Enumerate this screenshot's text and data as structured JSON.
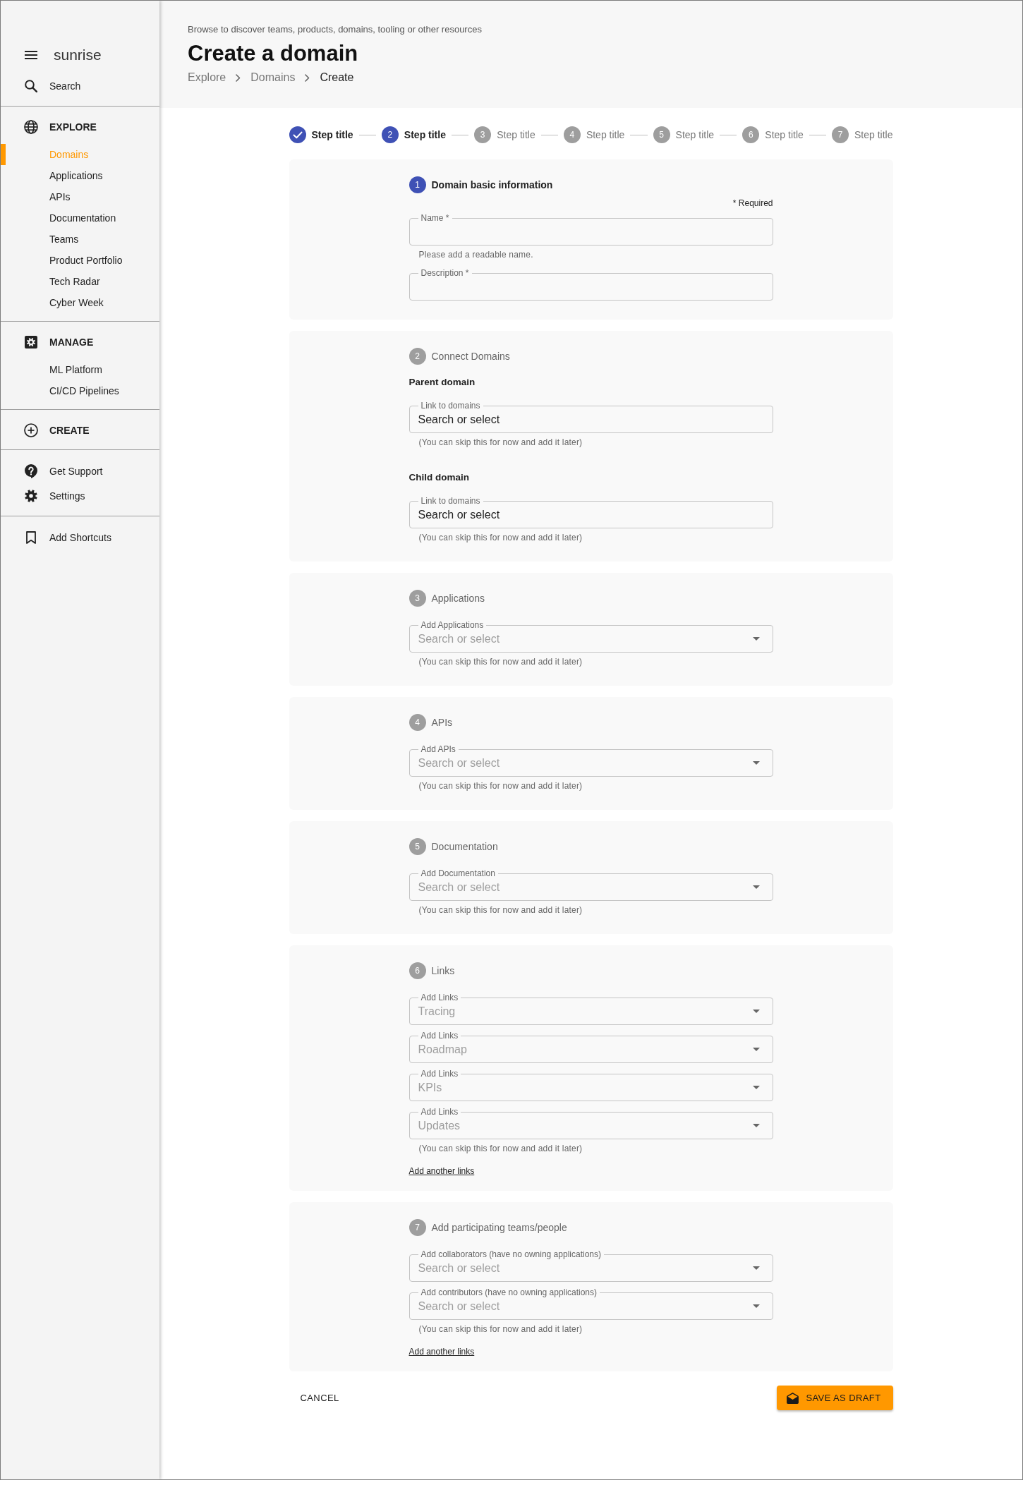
{
  "sidebar": {
    "brand": "sunrise",
    "search": "Search",
    "groups": [
      {
        "title": "EXPLORE",
        "items": [
          {
            "label": "Domains",
            "selected": true
          },
          {
            "label": "Applications",
            "selected": false
          },
          {
            "label": "APIs",
            "selected": false
          },
          {
            "label": "Documentation",
            "selected": false
          },
          {
            "label": "Teams",
            "selected": false
          },
          {
            "label": "Product Portfolio",
            "selected": false
          },
          {
            "label": "Tech Radar",
            "selected": false
          },
          {
            "label": "Cyber Week",
            "selected": false
          }
        ]
      },
      {
        "title": "MANAGE",
        "items": [
          {
            "label": "ML Platform",
            "selected": false
          },
          {
            "label": "CI/CD Pipelines",
            "selected": false
          }
        ]
      },
      {
        "title": "CREATE"
      }
    ],
    "support_links": [
      "Get Support",
      "Settings"
    ],
    "shortcuts": "Add Shortcuts"
  },
  "header": {
    "subtitle": "Browse to discover teams, products, domains, tooling or other resources",
    "title": "Create a domain",
    "breadcrumbs": [
      {
        "label": "Explore",
        "current": false
      },
      {
        "label": "Domains",
        "current": false
      },
      {
        "label": "Create",
        "current": true
      }
    ]
  },
  "stepper": {
    "steps": [
      {
        "label": "Step title",
        "completed": true,
        "selected": false
      },
      {
        "number": "2",
        "label": "Step title",
        "completed": false,
        "selected": true
      },
      {
        "number": "3",
        "label": "Step title",
        "completed": false,
        "selected": false
      },
      {
        "number": "4",
        "label": "Step title",
        "completed": false,
        "selected": false
      },
      {
        "number": "5",
        "label": "Step title",
        "completed": false,
        "selected": false
      },
      {
        "number": "6",
        "label": "Step title",
        "completed": false,
        "selected": false
      },
      {
        "number": "7",
        "label": "Step title",
        "completed": false,
        "selected": false
      }
    ]
  },
  "sections": [
    {
      "number": "1",
      "title": "Domain basic information",
      "active": true,
      "blocks": [
        {
          "kind": "note",
          "text": "* Required"
        },
        {
          "kind": "text_field",
          "label": "Name *",
          "helper": "Please add a readable name."
        },
        {
          "kind": "text_field",
          "label": "Description *"
        }
      ]
    },
    {
      "number": "2",
      "title": "Connect Domains",
      "active": false,
      "blocks": [
        {
          "kind": "subheading",
          "text": "Parent domain"
        },
        {
          "kind": "text_field",
          "label": "Link to domains",
          "value": "Search or select",
          "helper": "(You can skip this for now and add it later)"
        },
        {
          "kind": "subheading",
          "text": "Child domain"
        },
        {
          "kind": "text_field",
          "label": "Link to domains",
          "value": "Search or select",
          "helper": "(You can skip this for now and add it later)"
        }
      ]
    },
    {
      "number": "3",
      "title": "Applications",
      "active": false,
      "blocks": [
        {
          "kind": "select_field",
          "label": "Add Applications",
          "placeholder": "Search or select",
          "helper": "(You can skip this for now and add it later)"
        }
      ]
    },
    {
      "number": "4",
      "title": "APIs",
      "active": false,
      "blocks": [
        {
          "kind": "select_field",
          "label": "Add APIs",
          "placeholder": "Search or select",
          "helper": "(You can skip this for now and add it later)"
        }
      ]
    },
    {
      "number": "5",
      "title": "Documentation",
      "active": false,
      "blocks": [
        {
          "kind": "select_field",
          "label": "Add Documentation",
          "placeholder": "Search or select",
          "helper": "(You can skip this for now and add it later)"
        }
      ]
    },
    {
      "number": "6",
      "title": "Links",
      "active": false,
      "blocks": [
        {
          "kind": "select_field",
          "label": "Add Links",
          "placeholder": "Tracing"
        },
        {
          "kind": "select_field",
          "label": "Add Links",
          "placeholder": "Roadmap"
        },
        {
          "kind": "select_field",
          "label": "Add Links",
          "placeholder": "KPIs"
        },
        {
          "kind": "select_field",
          "label": "Add Links",
          "placeholder": "Updates",
          "helper": "(You can skip this for now and add it later)"
        },
        {
          "kind": "link",
          "text": "Add another links"
        }
      ]
    },
    {
      "number": "7",
      "title": "Add participating teams/people",
      "active": false,
      "blocks": [
        {
          "kind": "select_field",
          "label": "Add collaborators (have no owning applications)",
          "placeholder": "Search or select"
        },
        {
          "kind": "select_field",
          "label": "Add contributors (have no owning applications)",
          "placeholder": "Search or select",
          "helper": "(You can skip this for now and add it later)"
        },
        {
          "kind": "link",
          "text": "Add another links"
        }
      ]
    }
  ],
  "actions": {
    "cancel": "CANCEL",
    "save": "SAVE AS DRAFT"
  }
}
